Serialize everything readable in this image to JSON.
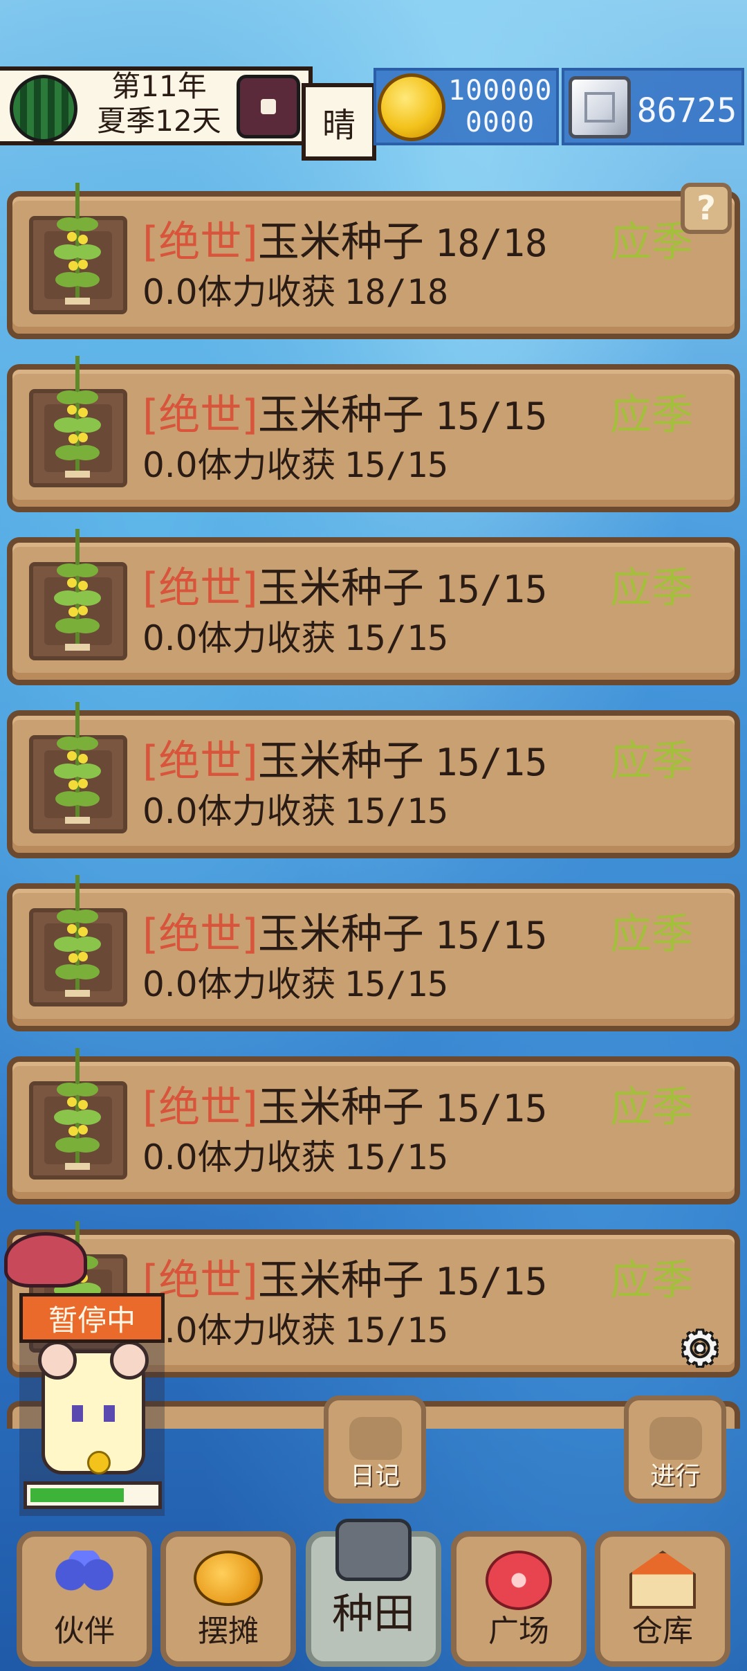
{
  "status_bar": {
    "year": "第11年",
    "season_day": "夏季12天",
    "weather": "晴",
    "coins_line1": "100000",
    "coins_line2": "0000",
    "gems": "86725"
  },
  "help_label": "?",
  "crops": [
    {
      "tag": "[绝世]",
      "name": "玉米种子",
      "count": "18/18",
      "season": "应季",
      "harvest": "0.0体力收获",
      "harvest_count": "18/18"
    },
    {
      "tag": "[绝世]",
      "name": "玉米种子",
      "count": "15/15",
      "season": "应季",
      "harvest": "0.0体力收获",
      "harvest_count": "15/15"
    },
    {
      "tag": "[绝世]",
      "name": "玉米种子",
      "count": "15/15",
      "season": "应季",
      "harvest": "0.0体力收获",
      "harvest_count": "15/15"
    },
    {
      "tag": "[绝世]",
      "name": "玉米种子",
      "count": "15/15",
      "season": "应季",
      "harvest": "0.0体力收获",
      "harvest_count": "15/15"
    },
    {
      "tag": "[绝世]",
      "name": "玉米种子",
      "count": "15/15",
      "season": "应季",
      "harvest": "0.0体力收获",
      "harvest_count": "15/15"
    },
    {
      "tag": "[绝世]",
      "name": "玉米种子",
      "count": "15/15",
      "season": "应季",
      "harvest": "0.0体力收获",
      "harvest_count": "15/15"
    },
    {
      "tag": "[绝世]",
      "name": "玉米种子",
      "count": "15/15",
      "season": "应季",
      "harvest": "0.0体力收获",
      "harvest_count": "15/15"
    }
  ],
  "pet": {
    "status": "暂停中",
    "stamina_fraction": 0.75
  },
  "floating_buttons": {
    "diary": "日记",
    "proceed": "进行"
  },
  "nav": {
    "partner": "伙伴",
    "stall": "摆摊",
    "farm": "种田",
    "plaza": "广场",
    "storage": "仓库"
  },
  "icons": {
    "weather": "sun-icon",
    "settings": "gear-icon"
  },
  "colors": {
    "rarity_tag": "#d8543a",
    "season_tag": "#a3bf3c",
    "pause_badge": "#ea6a2c",
    "stamina": "#3db33a"
  }
}
